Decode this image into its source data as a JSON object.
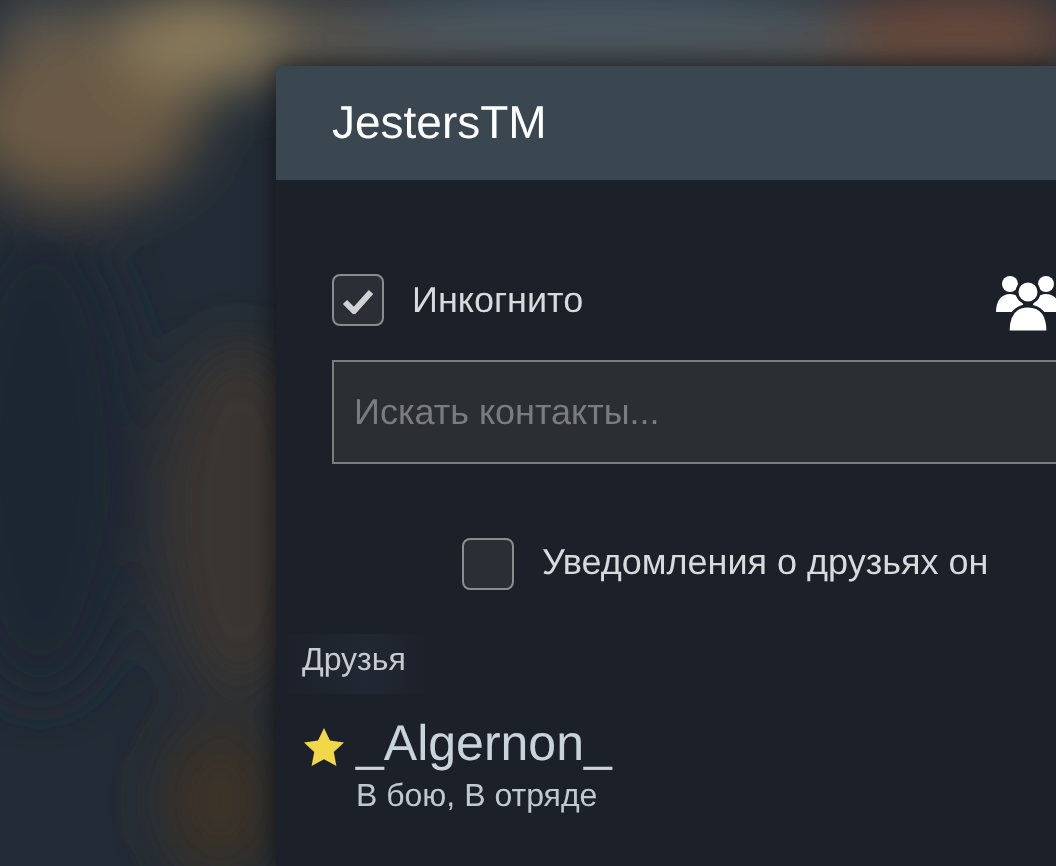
{
  "window": {
    "title": "JestersTM"
  },
  "incognito": {
    "label": "Инкогнито",
    "checked": true
  },
  "search": {
    "placeholder": "Искать контакты..."
  },
  "notifications": {
    "label": "Уведомления о друзьях он",
    "checked": false
  },
  "friends": {
    "heading": "Друзья",
    "items": [
      {
        "name": "_Algernon_",
        "status": "В бою, В отряде",
        "favorite": true
      }
    ]
  }
}
